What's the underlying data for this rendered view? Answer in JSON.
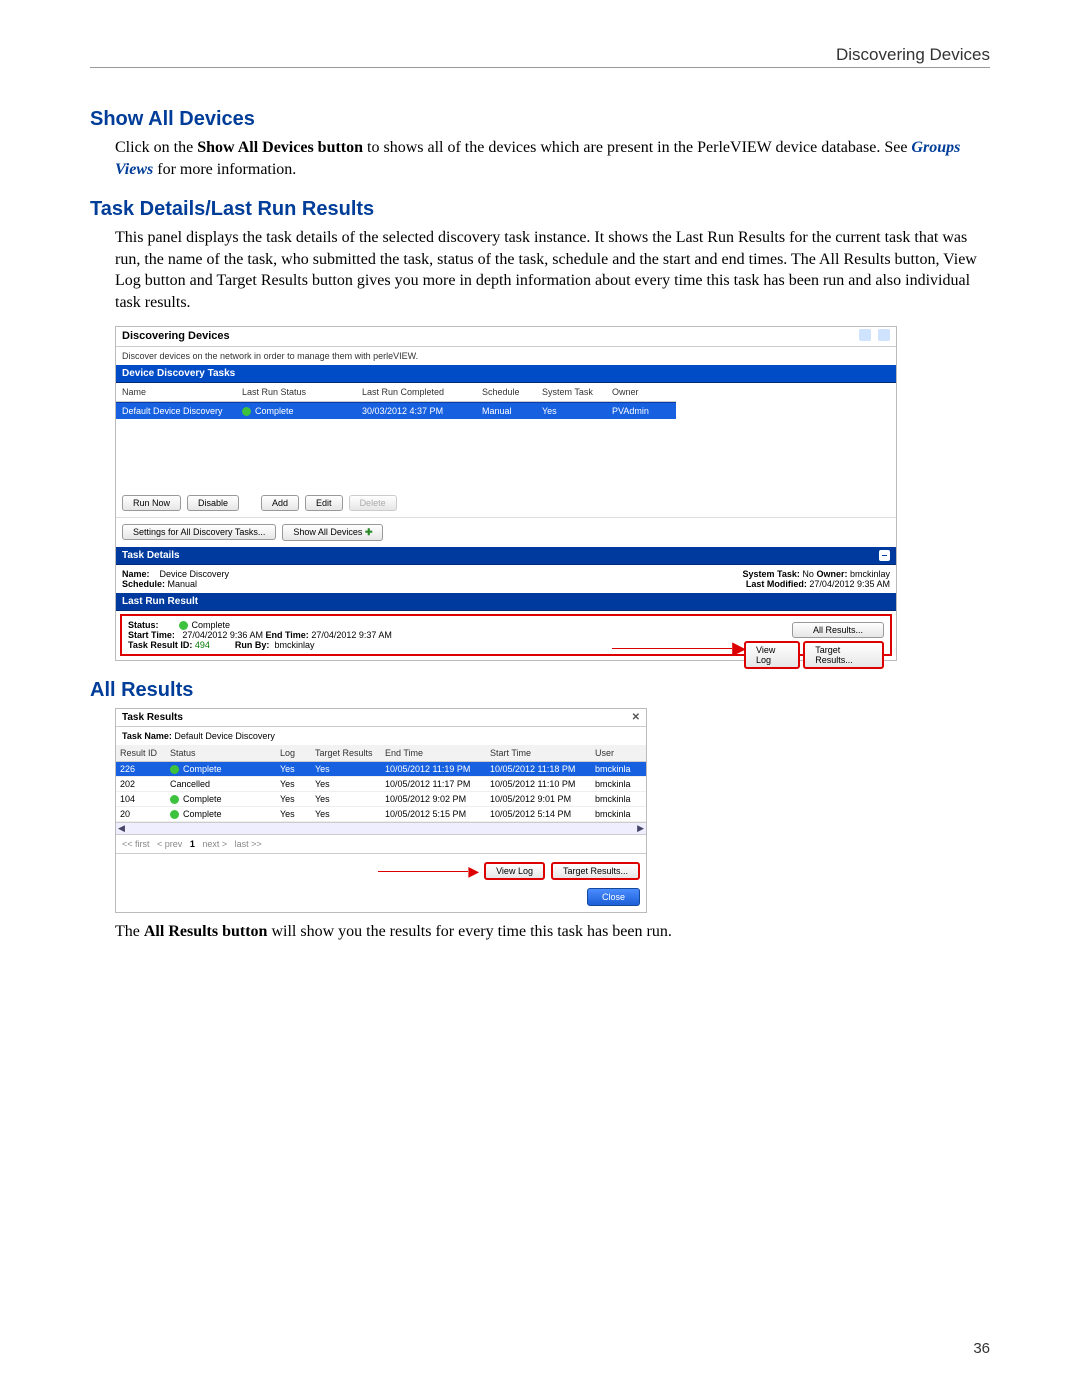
{
  "header": {
    "doc_section": "Discovering Devices",
    "page_num": "36"
  },
  "section1": {
    "heading": "Show All Devices",
    "para_1a": "Click on the ",
    "para_1b_bold": "Show All Devices button",
    "para_1c": " to shows all of the devices which are present in the PerleVIEW device database. See ",
    "link": "Groups Views",
    "para_1d": "  for more information."
  },
  "section2": {
    "heading": "Task Details/Last Run Results",
    "para": "This panel displays the task details of the selected discovery task instance. It shows the Last Run Results for the current task that was run, the name of the task, who submitted the task, status of the task, schedule and the start and end times. The All Results button, View Log button and Target Results button gives you more in depth information about every time this task has been run and also individual task results."
  },
  "panel1": {
    "title": "Discovering Devices",
    "desc": "Discover devices on the network in order to manage them with perleVIEW.",
    "tasks_header": "Device Discovery Tasks",
    "cols": {
      "name": "Name",
      "last_run_status": "Last Run Status",
      "last_run_completed": "Last Run Completed",
      "schedule": "Schedule",
      "system_task": "System Task",
      "owner": "Owner"
    },
    "row": {
      "name": "Default Device Discovery",
      "status": "Complete",
      "completed": "30/03/2012 4:37 PM",
      "schedule": "Manual",
      "system_task": "Yes",
      "owner": "PVAdmin"
    },
    "buttons": {
      "run_now": "Run Now",
      "disable": "Disable",
      "add": "Add",
      "edit": "Edit",
      "delete": "Delete",
      "settings": "Settings for All Discovery Tasks...",
      "show_all": "Show All Devices"
    },
    "task_details_header": "Task Details",
    "details": {
      "name_lbl": "Name:",
      "name_val": "Device Discovery",
      "schedule_lbl": "Schedule:",
      "schedule_val": "Manual",
      "system_task_lbl": "System Task:",
      "system_task_val": "No",
      "owner_lbl": "Owner:",
      "owner_val": "bmckinlay",
      "last_mod_lbl": "Last Modified:",
      "last_mod_val": "27/04/2012 9:35 AM"
    },
    "last_run_result_header": "Last Run Result",
    "result": {
      "status_lbl": "Status:",
      "status_val": "Complete",
      "start_lbl": "Start Time:",
      "start_val": "27/04/2012 9:36 AM",
      "end_lbl": "End Time:",
      "end_val": "27/04/2012 9:37 AM",
      "result_id_lbl": "Task Result ID:",
      "result_id_val": "494",
      "run_by_lbl": "Run By:",
      "run_by_val": "bmckinlay"
    },
    "rbtns": {
      "all_results": "All Results...",
      "view_log": "View Log",
      "target_results": "Target Results..."
    }
  },
  "section3": {
    "heading": "All Results"
  },
  "panel2": {
    "title": "Task Results",
    "task_name_lbl": "Task Name:",
    "task_name_val": "Default Device Discovery",
    "cols": {
      "result_id": "Result ID",
      "status": "Status",
      "log": "Log",
      "target_results": "Target Results",
      "end_time": "End Time",
      "start_time": "Start Time",
      "user": "User"
    },
    "rows": [
      {
        "id": "226",
        "status": "Complete",
        "icon": true,
        "log": "Yes",
        "tr": "Yes",
        "end": "10/05/2012 11:19 PM",
        "start": "10/05/2012 11:18 PM",
        "user": "bmckinla"
      },
      {
        "id": "202",
        "status": "Cancelled",
        "icon": false,
        "log": "Yes",
        "tr": "Yes",
        "end": "10/05/2012 11:17 PM",
        "start": "10/05/2012 11:10 PM",
        "user": "bmckinla"
      },
      {
        "id": "104",
        "status": "Complete",
        "icon": true,
        "log": "Yes",
        "tr": "Yes",
        "end": "10/05/2012 9:02 PM",
        "start": "10/05/2012 9:01 PM",
        "user": "bmckinla"
      },
      {
        "id": "20",
        "status": "Complete",
        "icon": true,
        "log": "Yes",
        "tr": "Yes",
        "end": "10/05/2012 5:15 PM",
        "start": "10/05/2012 5:14 PM",
        "user": "bmckinla"
      }
    ],
    "pager": {
      "first": "<< first",
      "prev": "< prev",
      "page": "1",
      "next": "next >",
      "last": "last >>"
    },
    "buttons": {
      "view_log": "View Log",
      "target_results": "Target Results...",
      "close": "Close"
    }
  },
  "section3_footer": {
    "a": "The ",
    "b_bold": "All Results button",
    "c": " will show you the results for every time this task has been run."
  }
}
